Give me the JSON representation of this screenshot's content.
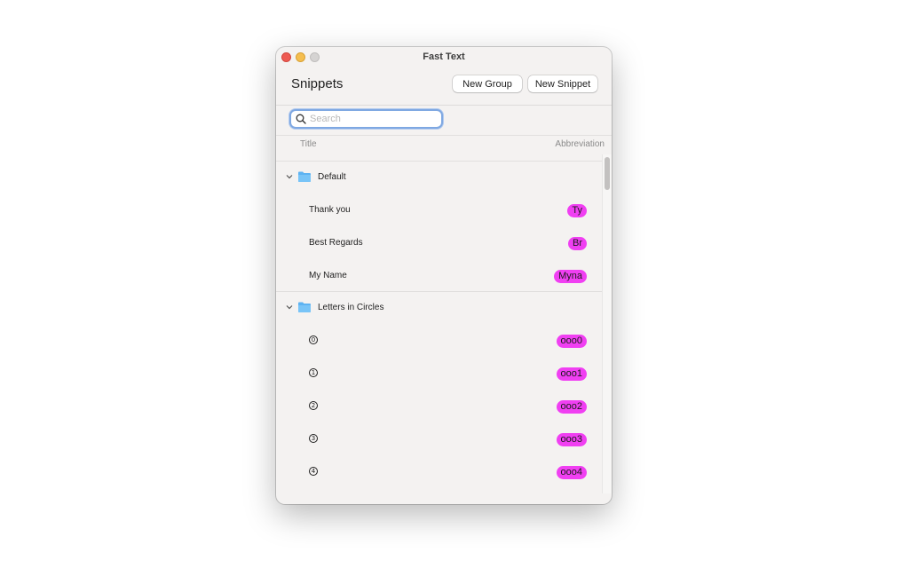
{
  "window": {
    "title": "Fast Text"
  },
  "toolbar": {
    "page_title": "Snippets",
    "new_group_label": "New Group",
    "new_snippet_label": "New Snippet"
  },
  "search": {
    "placeholder": "Search",
    "value": ""
  },
  "columns": {
    "title": "Title",
    "abbreviation": "Abbreviation"
  },
  "colors": {
    "badge": "#f03ff2",
    "focus_ring": "#7fa8e2",
    "folder": "#5db3f2"
  },
  "groups": [
    {
      "name": "Default",
      "expanded": true,
      "items": [
        {
          "title": "Thank you",
          "abbreviation": "Ty"
        },
        {
          "title": "Best Regards",
          "abbreviation": "Br"
        },
        {
          "title": "My Name",
          "abbreviation": "Myna"
        }
      ]
    },
    {
      "name": "Letters in Circles",
      "expanded": true,
      "items": [
        {
          "title": "0",
          "abbreviation": "ooo0"
        },
        {
          "title": "1",
          "abbreviation": "ooo1"
        },
        {
          "title": "2",
          "abbreviation": "ooo2"
        },
        {
          "title": "3",
          "abbreviation": "ooo3"
        },
        {
          "title": "4",
          "abbreviation": "ooo4"
        }
      ]
    }
  ]
}
